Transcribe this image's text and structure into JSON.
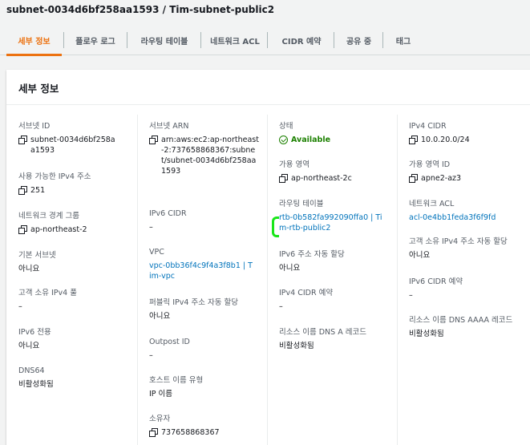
{
  "title": "subnet-0034d6bf258aa1593 / Tim-subnet-public2",
  "tabs": [
    {
      "label": "세부 정보",
      "active": true
    },
    {
      "label": "플로우 로그"
    },
    {
      "label": "라우팅 테이블"
    },
    {
      "label": "네트워크 ACL"
    },
    {
      "label": "CIDR 예약"
    },
    {
      "label": "공유 중"
    },
    {
      "label": "태그"
    }
  ],
  "panel": {
    "title": "세부 정보"
  },
  "col1": {
    "subnet_id": {
      "label": "서브넷 ID",
      "value": "subnet-0034d6bf258aa1593"
    },
    "available_ipv4": {
      "label": "사용 가능한 IPv4 주소",
      "value": "251"
    },
    "network_border_group": {
      "label": "네트워크 경계 그룹",
      "value": "ap-northeast-2"
    },
    "default_subnet": {
      "label": "기본 서브넷",
      "value": "아니요"
    },
    "customer_owned_pool": {
      "label": "고객 소유 IPv4 풀",
      "value": "–"
    },
    "ipv6_only": {
      "label": "IPv6 전용",
      "value": "아니요"
    },
    "dns64": {
      "label": "DNS64",
      "value": "비활성화됨"
    }
  },
  "col2": {
    "subnet_arn": {
      "label": "서브넷 ARN",
      "value": "arn:aws:ec2:ap-northeast-2:737658868367:subnet/subnet-0034d6bf258aa1593"
    },
    "ipv6_cidr": {
      "label": "IPv6 CIDR",
      "value": "–"
    },
    "vpc": {
      "label": "VPC",
      "value": "vpc-0bb36f4c9f4a3f8b1 | Tim-vpc"
    },
    "auto_assign_public_ipv4": {
      "label": "퍼블릭 IPv4 주소 자동 할당",
      "value": "아니요"
    },
    "outpost_id": {
      "label": "Outpost ID",
      "value": "–"
    },
    "hostname_type": {
      "label": "호스트 이름 유형",
      "value": "IP 이름"
    },
    "owner": {
      "label": "소유자",
      "value": "737658868367"
    }
  },
  "col3": {
    "state": {
      "label": "상태",
      "value": "Available"
    },
    "availability_zone": {
      "label": "가용 영역",
      "value": "ap-northeast-2c"
    },
    "route_table": {
      "label": "라우팅 테이블",
      "value": "rtb-0b582fa992090ffa0 | Tim-rtb-public2"
    },
    "auto_assign_ipv6": {
      "label": "IPv6 주소 자동 할당",
      "value": "아니요"
    },
    "ipv4_cidr_reservation": {
      "label": "IPv4 CIDR 예약",
      "value": "–"
    },
    "resource_dns_a": {
      "label": "리소스 이름 DNS A 레코드",
      "value": "비활성화됨"
    }
  },
  "col4": {
    "ipv4_cidr": {
      "label": "IPv4 CIDR",
      "value": "10.0.20.0/24"
    },
    "az_id": {
      "label": "가용 영역 ID",
      "value": "apne2-az3"
    },
    "network_acl": {
      "label": "네트워크 ACL",
      "value": "acl-0e4bb1feda3f6f9fd"
    },
    "auto_assign_customer_ipv4": {
      "label": "고객 소유 IPv4 주소 자동 할당",
      "value": "아니요"
    },
    "ipv6_cidr_reservation": {
      "label": "IPv6 CIDR 예약",
      "value": "–"
    },
    "resource_dns_aaaa": {
      "label": "리소스 이름 DNS AAAA 레코드",
      "value": "비활성화됨"
    }
  },
  "colors": {
    "accent": "#ec7211",
    "link": "#0073bb",
    "success": "#1d8102",
    "annotation": "#19e619"
  }
}
